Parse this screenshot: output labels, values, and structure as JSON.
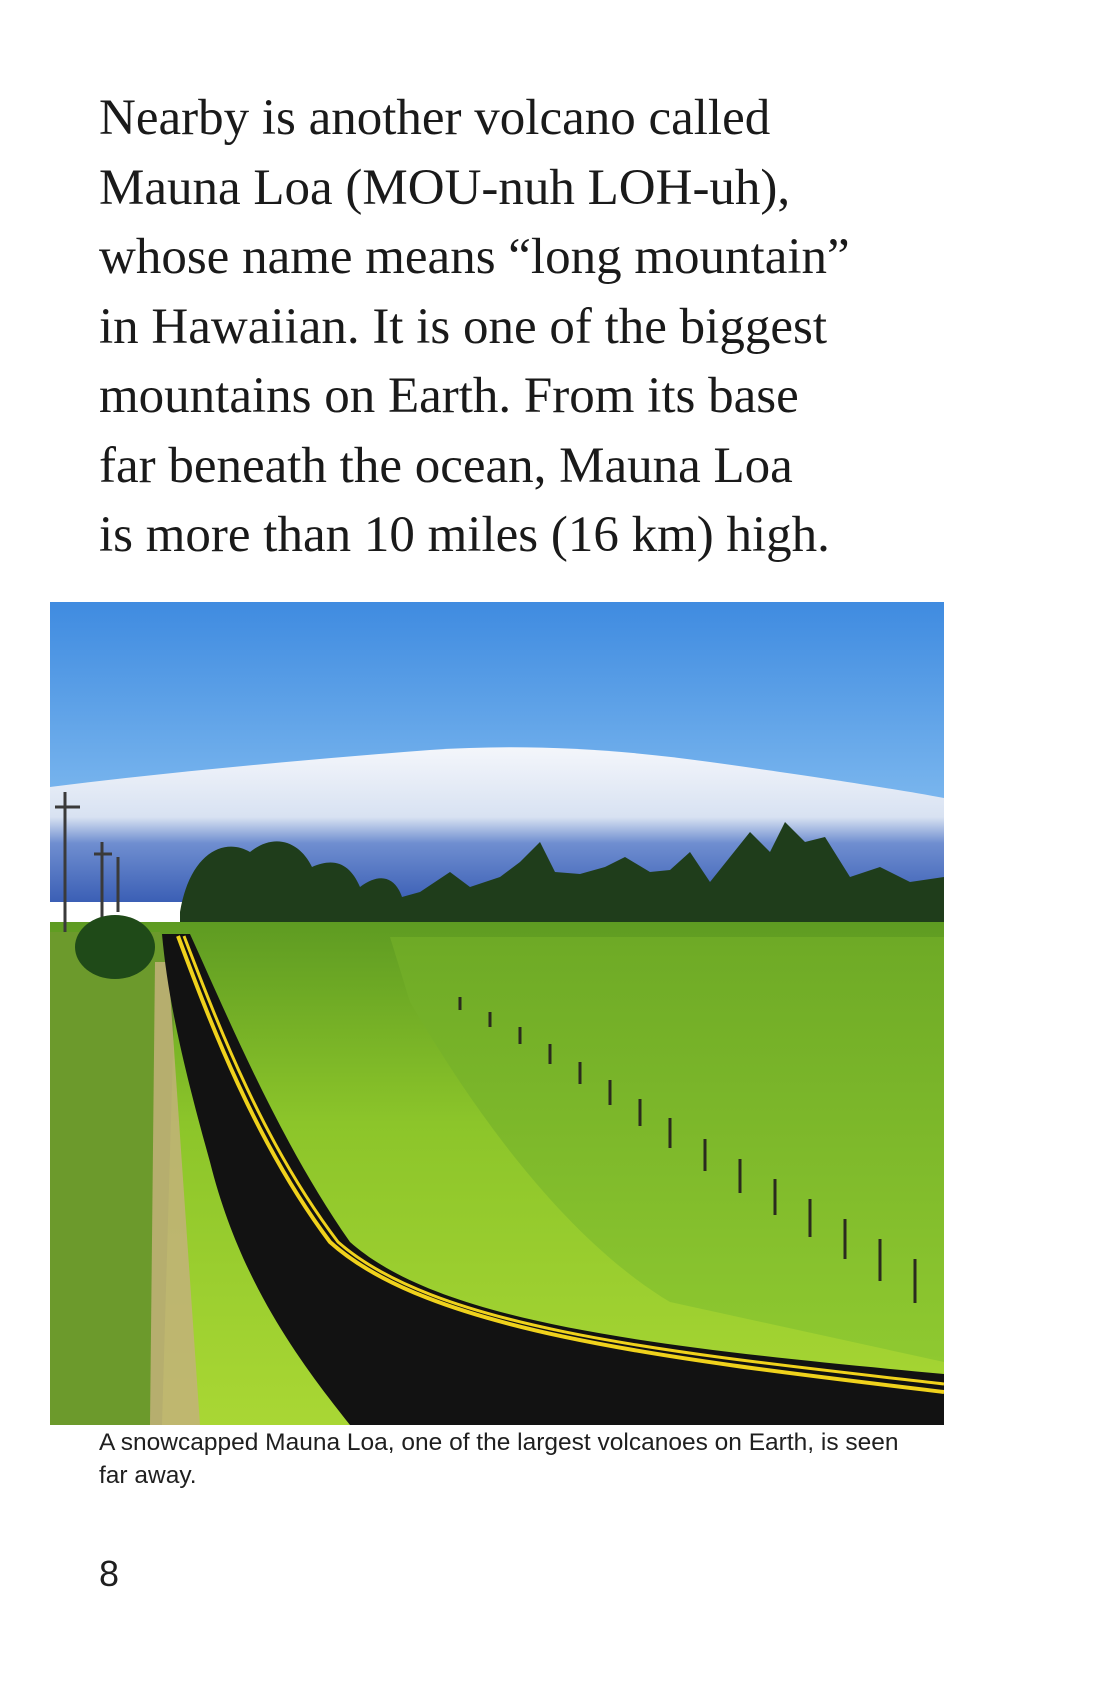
{
  "body_text": {
    "lines": [
      "Nearby is another volcano called",
      "Mauna Loa (MOU-nuh LOH-uh),",
      "whose name means “long mountain”",
      "in Hawaiian. It is one of the biggest",
      "mountains on Earth. From its base",
      "far beneath the ocean, Mauna Loa",
      "is more than 10 miles (16 km) high."
    ]
  },
  "photo": {
    "colors": {
      "sky_top": "#3f8be0",
      "sky_bottom": "#7ab6ee",
      "snow": "#eef2f8",
      "mountain_base": "#3f63b8",
      "grass": "#7dba2a",
      "grass_bright": "#a6d62e",
      "road": "#141414",
      "center_line": "#f0d21c",
      "trees": "#1d3a1a"
    }
  },
  "caption": "A snowcapped Mauna Loa, one of the largest volcanoes on Earth, is seen far away.",
  "page_number": "8"
}
